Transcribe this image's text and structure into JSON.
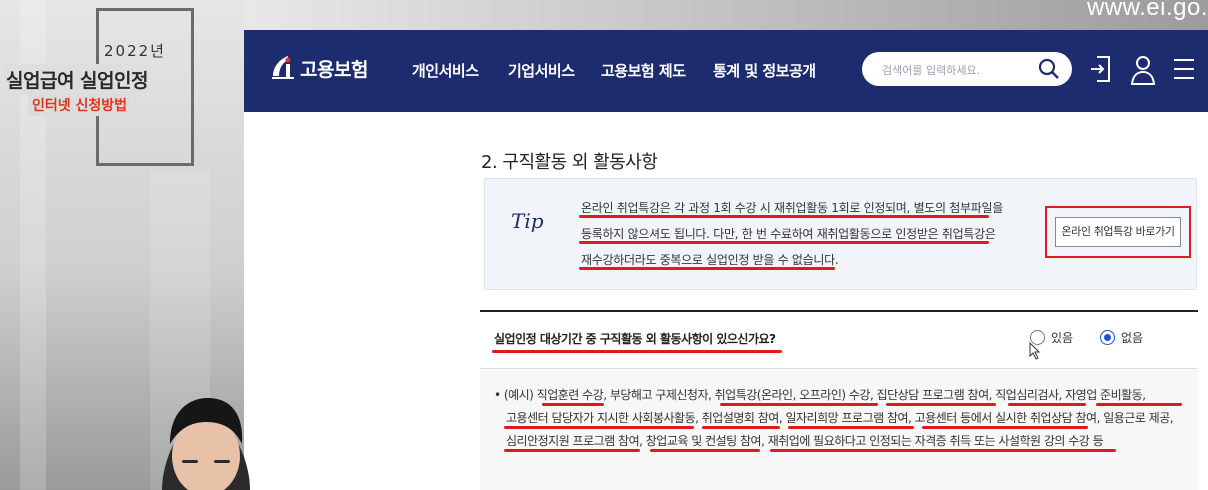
{
  "overlay": {
    "year": "2022년",
    "title": "실업급여 실업인정",
    "subtitle": "인터넷 신청방법",
    "url": "www.ei.go."
  },
  "navbar": {
    "logo_text": "고용보험",
    "items": [
      "개인서비스",
      "기업서비스",
      "고용보험 제도",
      "통계 및 정보공개"
    ],
    "search_placeholder": "검색어를 입력하세요.",
    "icons": [
      "search-icon",
      "login-icon",
      "user-icon",
      "menu-icon"
    ]
  },
  "section": {
    "title": "2. 구직활동 외 활동사항"
  },
  "tip": {
    "label": "Tip",
    "lines": [
      "온라인 취업특강은 각 과정 1회 수강 시 재취업활동 1회로 인정되며, 별도의 첨부파일을",
      "등록하지 않으셔도 됩니다. 다만, 한 번 수료하여 재취업활동으로 인정받은 취업특강은",
      "재수강하더라도 중복으로 실업인정 받을 수 없습니다."
    ],
    "button_label": "온라인 취업특강 바로가기"
  },
  "question": {
    "text": "실업인정 대상기간 중 구직활동 외 활동사항이 있으신가요?",
    "options": [
      "있음",
      "없음"
    ],
    "selected": "없음"
  },
  "example": {
    "lines": [
      "• (예시) 직업훈련 수강, 부당해고 구제신청자, 취업특강(온라인, 오프라인) 수강, 집단상담 프로그램 참여, 직업심리검사, 자영업 준비활동,",
      "고용센터 담당자가 지시한 사회봉사활동, 취업설명회 참여, 일자리희망 프로그램 참여, 고용센터 등에서 실시한 취업상담 참여, 일용근로 제공,",
      "심리안정지원 프로그램 참여, 창업교육 및 컨설팅 참여, 재취업에 필요하다고 인정되는 자격증 취득 또는 사설학원 강의 수강 등"
    ]
  },
  "colors": {
    "navbar": "#1c2c6e",
    "highlight": "#e11b1b",
    "radio_selected": "#1a4fd8"
  }
}
